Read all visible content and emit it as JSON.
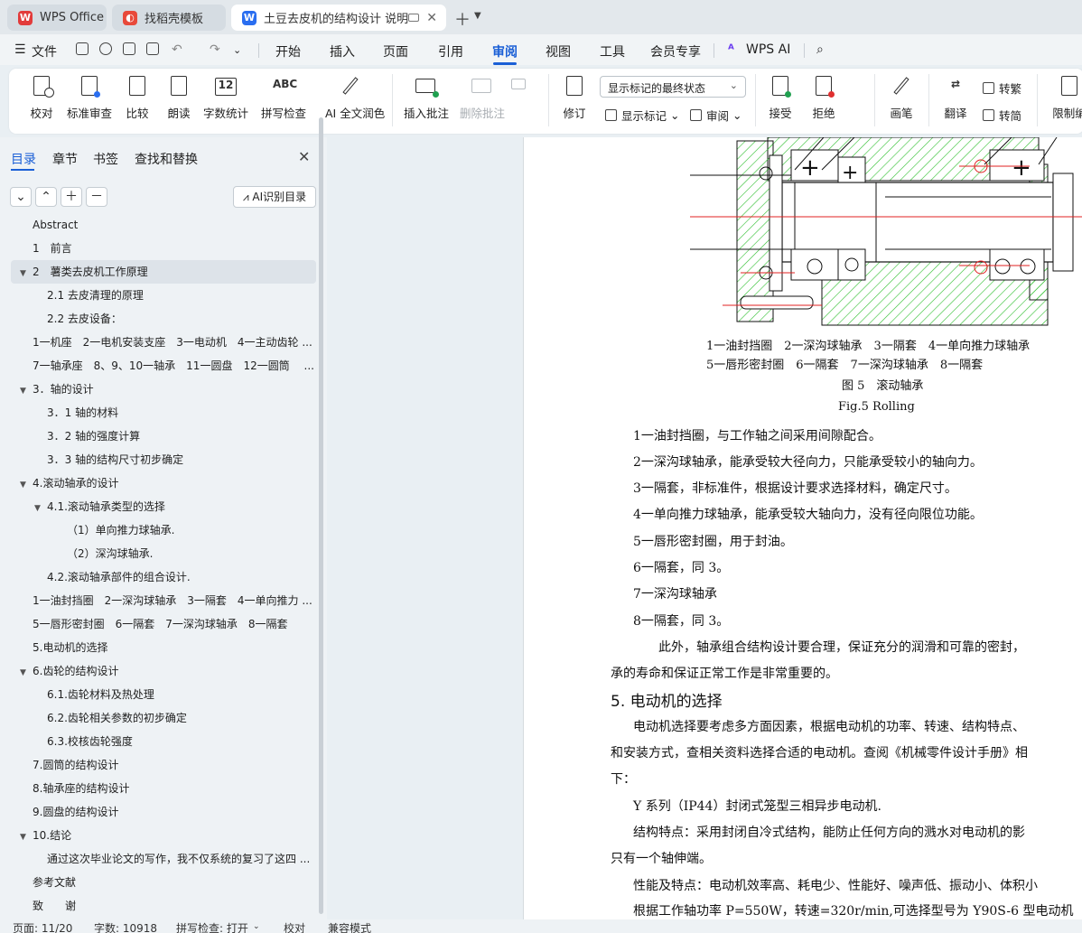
{
  "tabs": [
    {
      "label": "WPS Office",
      "active": false
    },
    {
      "label": "找稻壳模板",
      "active": false
    },
    {
      "label": "土豆去皮机的结构设计 说明书",
      "active": true
    }
  ],
  "menu": {
    "file": "文件",
    "items": [
      "开始",
      "插入",
      "页面",
      "引用",
      "审阅",
      "视图",
      "工具",
      "会员专享"
    ],
    "active": "审阅",
    "wps_ai": "WPS AI"
  },
  "ribbon": {
    "proofread": "校对",
    "standard_review": "标准审查",
    "compare": "比较",
    "read_aloud": "朗读",
    "word_count": "字数统计",
    "spell_check": "拼写检查",
    "ai_polish": "AI 全文润色",
    "insert_comment": "插入批注",
    "delete_comment": "删除批注",
    "track_changes": "修订",
    "markup_select": "显示标记的最终状态",
    "show_markup": "显示标记",
    "review": "审阅",
    "accept": "接受",
    "reject": "拒绝",
    "pen": "画笔",
    "translate": "翻译",
    "to_traditional": "转繁",
    "to_simplified": "转简",
    "restrict_edit": "限制编"
  },
  "nav": {
    "tabs": [
      "目录",
      "章节",
      "书签",
      "查找和替换"
    ],
    "ai_toc": "AI识别目录",
    "items": [
      {
        "text": "Abstract",
        "level": 0,
        "toggle": ""
      },
      {
        "text": "1　前言",
        "level": 0,
        "toggle": ""
      },
      {
        "text": "2　薯类去皮机工作原理",
        "level": 0,
        "toggle": "▼",
        "selected": true
      },
      {
        "text": "2.1 去皮清理的原理",
        "level": 1,
        "toggle": ""
      },
      {
        "text": "2.2 去皮设备：",
        "level": 1,
        "toggle": ""
      },
      {
        "text": "1一机座　2一电机安装支座　3一电动机　4一主动齿轮 ...",
        "level": 0,
        "toggle": ""
      },
      {
        "text": "7一轴承座　8、9、10一轴承　11一圆盘　12一圆筒　 ...",
        "level": 0,
        "toggle": ""
      },
      {
        "text": "3．轴的设计",
        "level": 0,
        "toggle": "▼"
      },
      {
        "text": "3．1 轴的材料",
        "level": 1,
        "toggle": ""
      },
      {
        "text": "3．2 轴的强度计算",
        "level": 1,
        "toggle": ""
      },
      {
        "text": "3．3 轴的结构尺寸初步确定",
        "level": 1,
        "toggle": ""
      },
      {
        "text": "4.滚动轴承的设计",
        "level": 0,
        "toggle": "▼"
      },
      {
        "text": "4.1.滚动轴承类型的选择",
        "level": 1,
        "toggle": "▼"
      },
      {
        "text": "（1）单向推力球轴承.",
        "level": 2,
        "toggle": ""
      },
      {
        "text": "（2）深沟球轴承.",
        "level": 2,
        "toggle": ""
      },
      {
        "text": "4.2.滚动轴承部件的组合设计.",
        "level": 1,
        "toggle": ""
      },
      {
        "text": "1一油封挡圈　2一深沟球轴承　3一隔套　4一单向推力 ...",
        "level": 0,
        "toggle": ""
      },
      {
        "text": "5一唇形密封圈　6一隔套　7一深沟球轴承　8一隔套",
        "level": 0,
        "toggle": ""
      },
      {
        "text": "5.电动机的选择",
        "level": 0,
        "toggle": ""
      },
      {
        "text": "6.齿轮的结构设计",
        "level": 0,
        "toggle": "▼"
      },
      {
        "text": "6.1.齿轮材料及热处理",
        "level": 1,
        "toggle": ""
      },
      {
        "text": "6.2.齿轮相关参数的初步确定",
        "level": 1,
        "toggle": ""
      },
      {
        "text": "6.3.校核齿轮强度",
        "level": 1,
        "toggle": ""
      },
      {
        "text": "7.圆筒的结构设计",
        "level": 0,
        "toggle": ""
      },
      {
        "text": "8.轴承座的结构设计",
        "level": 0,
        "toggle": ""
      },
      {
        "text": "9.圆盘的结构设计",
        "level": 0,
        "toggle": ""
      },
      {
        "text": "10.结论",
        "level": 0,
        "toggle": "▼"
      },
      {
        "text": "通过这次毕业论文的写作，我不仅系统的复习了这四 ...",
        "level": 1,
        "toggle": ""
      },
      {
        "text": "参考文献",
        "level": 0,
        "toggle": ""
      },
      {
        "text": "致　　谢",
        "level": 0,
        "toggle": ""
      }
    ]
  },
  "document": {
    "figure_legend_1": "1一油封挡圈　2一深沟球轴承　3一隔套　4一单向推力球轴承",
    "figure_legend_2": "5一唇形密封圈　6一隔套　7一深沟球轴承　8一隔套",
    "figure_caption_cn": "图 5　滚动轴承",
    "figure_caption_en": "Fig.5 Rolling",
    "list": [
      "1一油封挡圈，与工作轴之间采用间隙配合。",
      "2一深沟球轴承，能承受较大径向力，只能承受较小的轴向力。",
      "3一隔套，非标准件，根据设计要求选择材料，确定尺寸。",
      "4一单向推力球轴承，能承受较大轴向力，没有径向限位功能。",
      "5一唇形密封圈，用于封油。",
      "6一隔套，同 3。",
      "7一深沟球轴承",
      "8一隔套，同 3。"
    ],
    "para1_line1": "　　此外，轴承组合结构设计要合理，保证充分的润滑和可靠的密封，",
    "para1_line2": "承的寿命和保证正常工作是非常重要的。",
    "heading": "5. 电动机的选择",
    "para2_line1": "电动机选择要考虑多方面因素，根据电动机的功率、转速、结构特点、",
    "para2_line2": "和安装方式，查相关资料选择合适的电动机。查阅《机械零件设计手册》相",
    "para2_line3": "下：",
    "para3": "Y 系列（IP44）封闭式笼型三相异步电动机.",
    "para4_line1": "结构特点：采用封闭自冷式结构，能防止任何方向的溅水对电动机的影",
    "para4_line2": "只有一个轴伸端。",
    "para5": "性能及特点：电动机效率高、耗电少、性能好、噪声低、振动小、体积小",
    "para6": "根据工作轴功率 P=550W，转速=320r/min,可选择型号为 Y90S-6 型电动机"
  },
  "status": {
    "page": "页面: 11/20",
    "words": "字数: 10918",
    "spell": "拼写检查: 打开",
    "proof": "校对",
    "compat": "兼容模式"
  },
  "colors": {
    "accent": "#1a5fd6",
    "hatch": "#2fbf2f",
    "centerline": "#e02020"
  }
}
